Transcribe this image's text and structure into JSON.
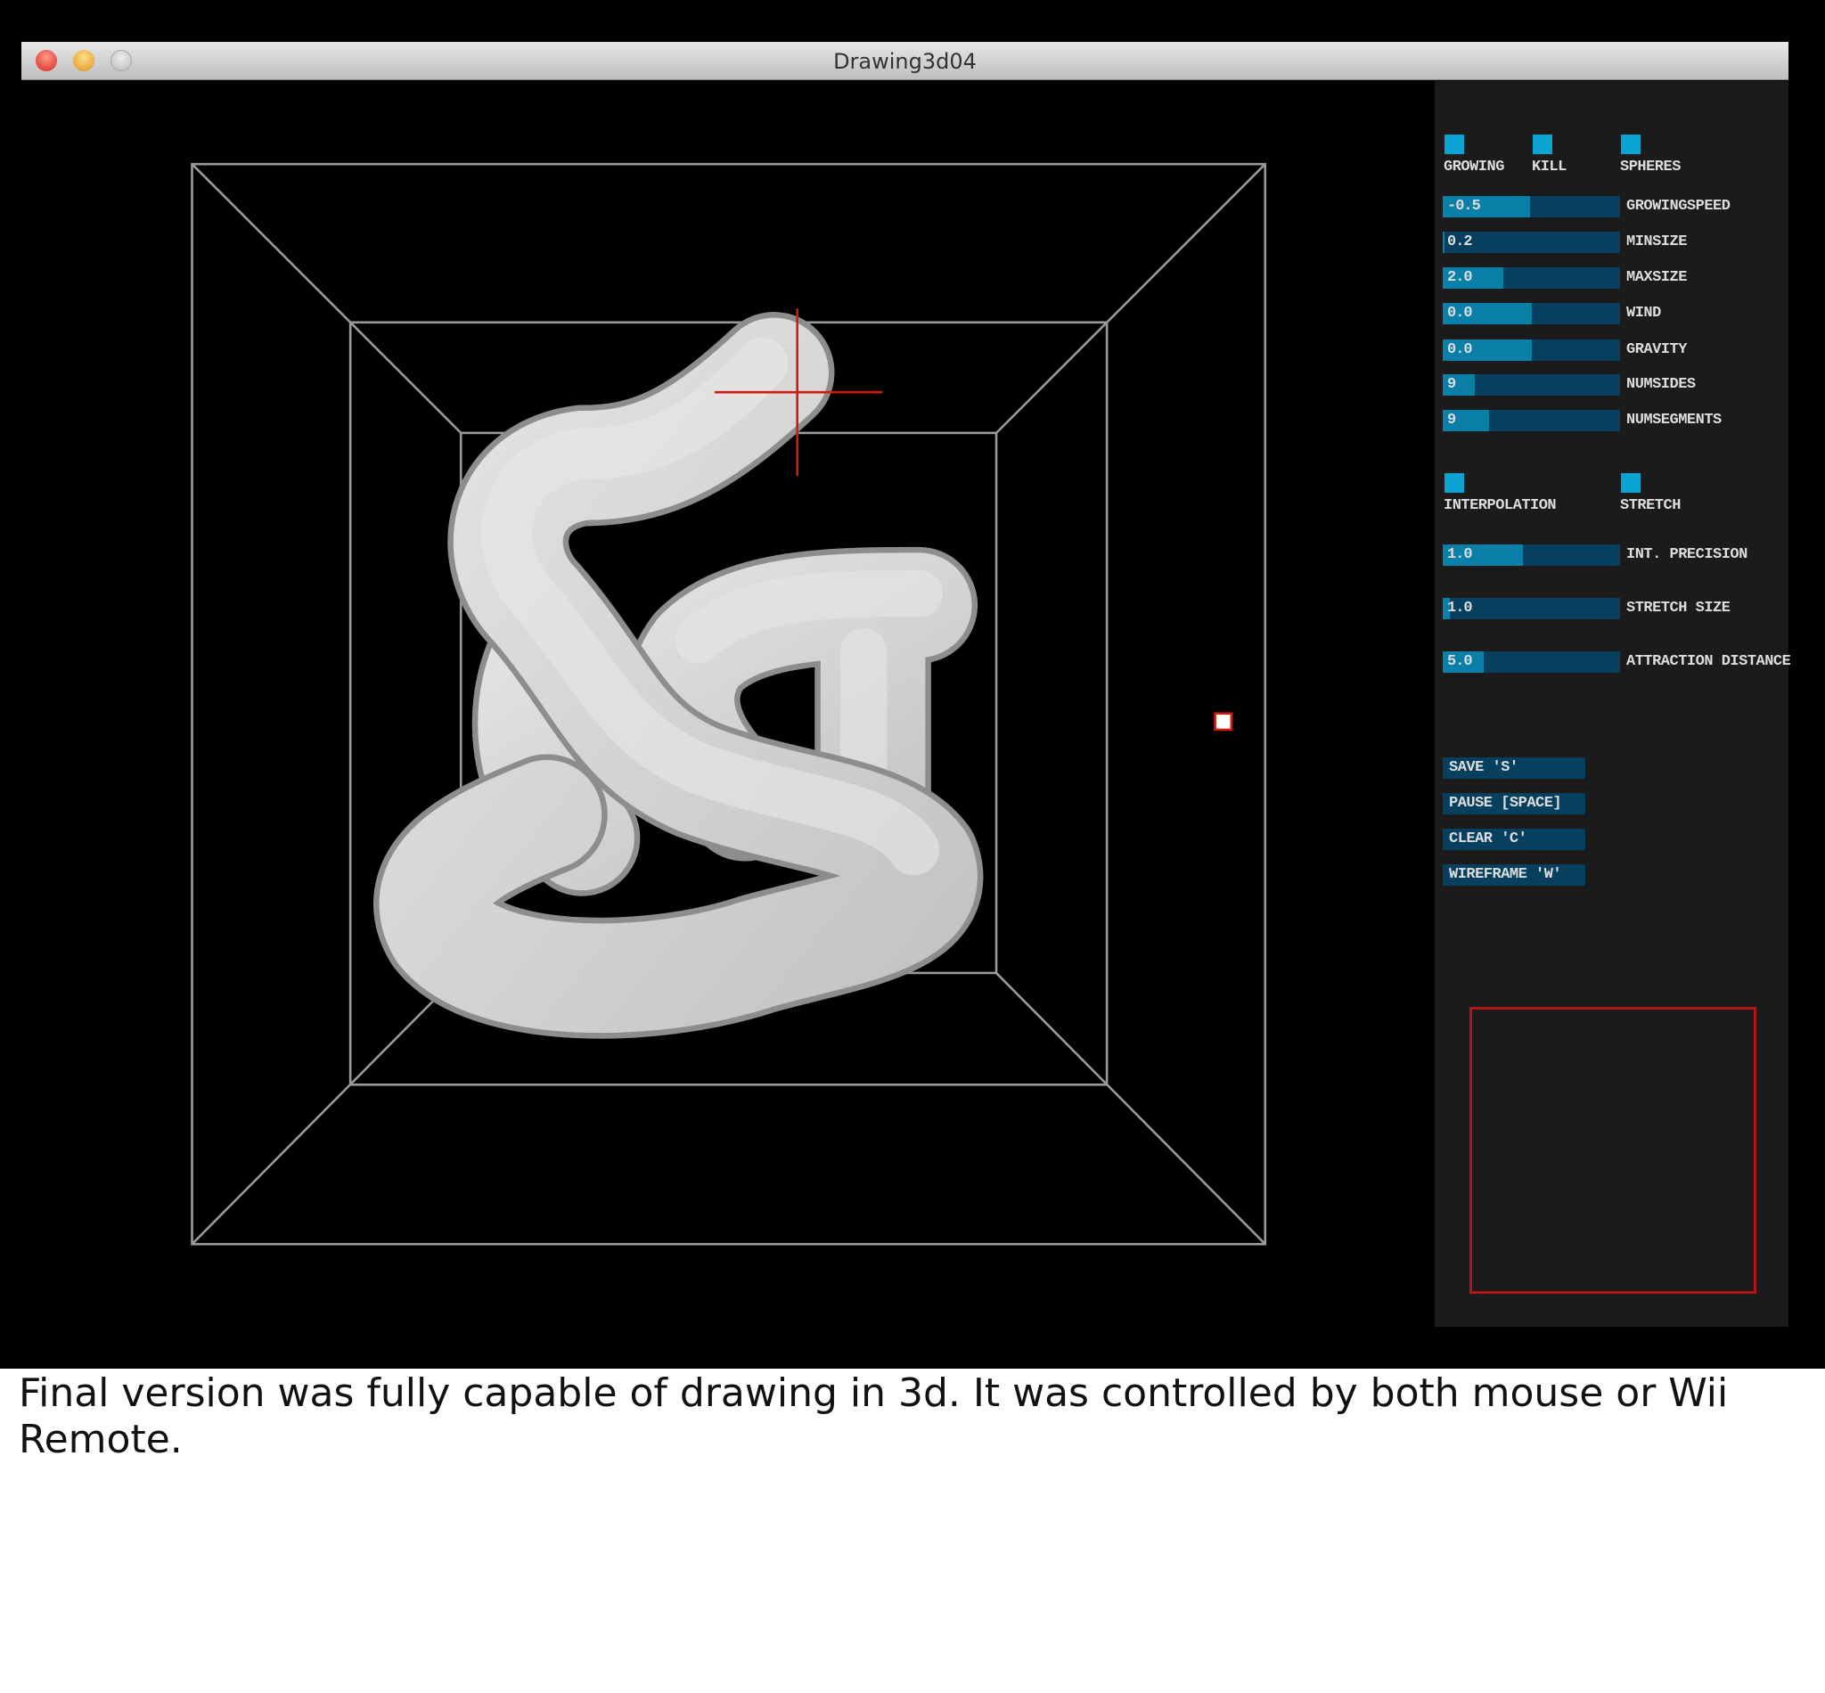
{
  "window": {
    "title": "Drawing3d04"
  },
  "checkboxes_top": [
    {
      "label": "GROWING",
      "checked": true
    },
    {
      "label": "KILL",
      "checked": true
    },
    {
      "label": "SPHERES",
      "checked": true
    }
  ],
  "sliders_top": [
    {
      "label": "GROWINGSPEED",
      "value": "-0.5",
      "fill": 0.49
    },
    {
      "label": "MINSIZE",
      "value": "0.2",
      "fill": 0.01
    },
    {
      "label": "MAXSIZE",
      "value": "2.0",
      "fill": 0.34
    },
    {
      "label": "WIND",
      "value": "0.0",
      "fill": 0.5
    },
    {
      "label": "GRAVITY",
      "value": "0.0",
      "fill": 0.5
    },
    {
      "label": "NUMSIDES",
      "value": "9",
      "fill": 0.18
    },
    {
      "label": "NUMSEGMENTS",
      "value": "9",
      "fill": 0.26
    }
  ],
  "checkboxes_mid": [
    {
      "label": "INTERPOLATION",
      "checked": true
    },
    {
      "label": "STRETCH",
      "checked": true
    }
  ],
  "sliders_mid": [
    {
      "label": "INT. PRECISION",
      "value": "1.0",
      "fill": 0.45
    },
    {
      "label": "STRETCH SIZE",
      "value": "1.0",
      "fill": 0.04
    },
    {
      "label": "ATTRACTION DISTANCE",
      "value": "5.0",
      "fill": 0.23
    }
  ],
  "buttons": [
    {
      "label": "SAVE 'S'"
    },
    {
      "label": "PAUSE [SPACE]"
    },
    {
      "label": "CLEAR 'C'"
    },
    {
      "label": "WIREFRAME 'W'"
    }
  ],
  "colors": {
    "accent": "#0aa4d2",
    "slider_bg": "#07405f",
    "slider_fill": "#0a7fa8",
    "cursor": "#d01a10"
  },
  "caption": "Final version was fully capable of drawing in 3d. It was controlled by both mouse or Wii Remote."
}
